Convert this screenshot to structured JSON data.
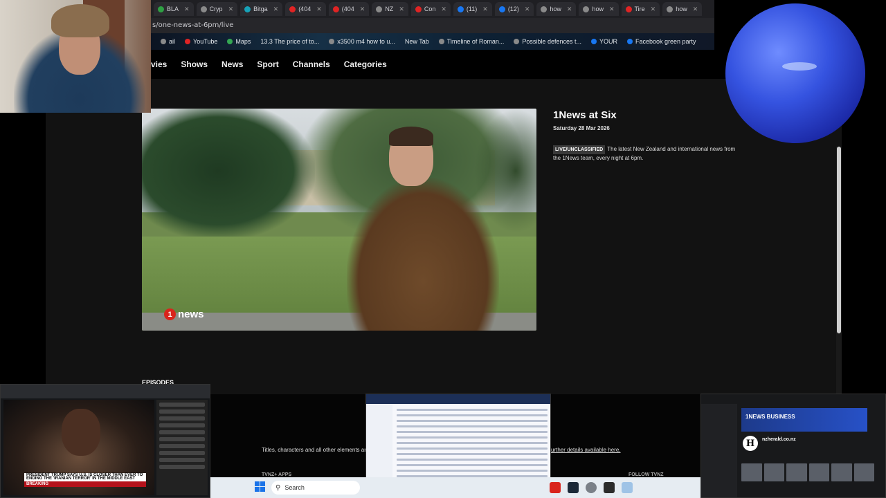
{
  "browser": {
    "tabs": [
      {
        "label": "BLA",
        "color": "#2ea043"
      },
      {
        "label": "Cryp",
        "color": "#8a8a8a"
      },
      {
        "label": "Bitga",
        "color": "#17a2b8"
      },
      {
        "label": "(404",
        "color": "#e02424"
      },
      {
        "label": "(404",
        "color": "#e02424"
      },
      {
        "label": "NZ",
        "color": "#8a8a8a"
      },
      {
        "label": "Con",
        "color": "#e02424"
      },
      {
        "label": "(11)",
        "color": "#1877f2"
      },
      {
        "label": "(12)",
        "color": "#1877f2"
      },
      {
        "label": "how",
        "color": "#8a8a8a"
      },
      {
        "label": "how",
        "color": "#8a8a8a"
      },
      {
        "label": "Tire",
        "color": "#e02424"
      },
      {
        "label": "how",
        "color": "#8a8a8a"
      }
    ],
    "url": "s/one-news-at-6pm/live",
    "bookmarks": [
      {
        "label": "ail",
        "color": "#8a8a8a"
      },
      {
        "label": "YouTube",
        "color": "#e02424"
      },
      {
        "label": "Maps",
        "color": "#34a853"
      },
      {
        "label": "13.3 The price of to...",
        "color": ""
      },
      {
        "label": "x3500 m4 how to u...",
        "color": "#8a8a8a"
      },
      {
        "label": "New Tab",
        "color": ""
      },
      {
        "label": "Timeline of Roman...",
        "color": "#8a8a8a"
      },
      {
        "label": "Possible defences t...",
        "color": "#8a8a8a"
      },
      {
        "label": "YOUR",
        "color": "#1877f2"
      },
      {
        "label": "Facebook green party",
        "color": "#1877f2"
      }
    ]
  },
  "site": {
    "nav": [
      "vies",
      "Shows",
      "News",
      "Sport",
      "Channels",
      "Categories"
    ],
    "show_title": "1News at Six",
    "show_date": "Saturday 28 Mar 2026",
    "badge": "LIVE/UNCLASSIFIED",
    "description": "The latest New Zealand and international news from the 1News team, every night at 6pm.",
    "logo_mark": "1",
    "logo_text": "news",
    "episodes_heading": "EPISODES",
    "footer_text": "Titles, characters and all other elements are",
    "footer_link": "urther details available here.",
    "apps_heading": "TVNZ+ APPS",
    "follow_heading": "FOLLOW TVNZ"
  },
  "thumbnails": {
    "aj_banner": "PRESIDENT TRUMP SAYS U.S. IS CLOSER THAN EVER TO ENDING THE 'IRANIAN TERROR' IN THE MIDDLE EAST",
    "aj_breaking": "BREAKING",
    "nz_banner": "1NEWS BUSINESS",
    "nz_logo": "H",
    "nz_name": "nzherald.co.nz"
  },
  "taskbar": {
    "search_label": "Search"
  }
}
